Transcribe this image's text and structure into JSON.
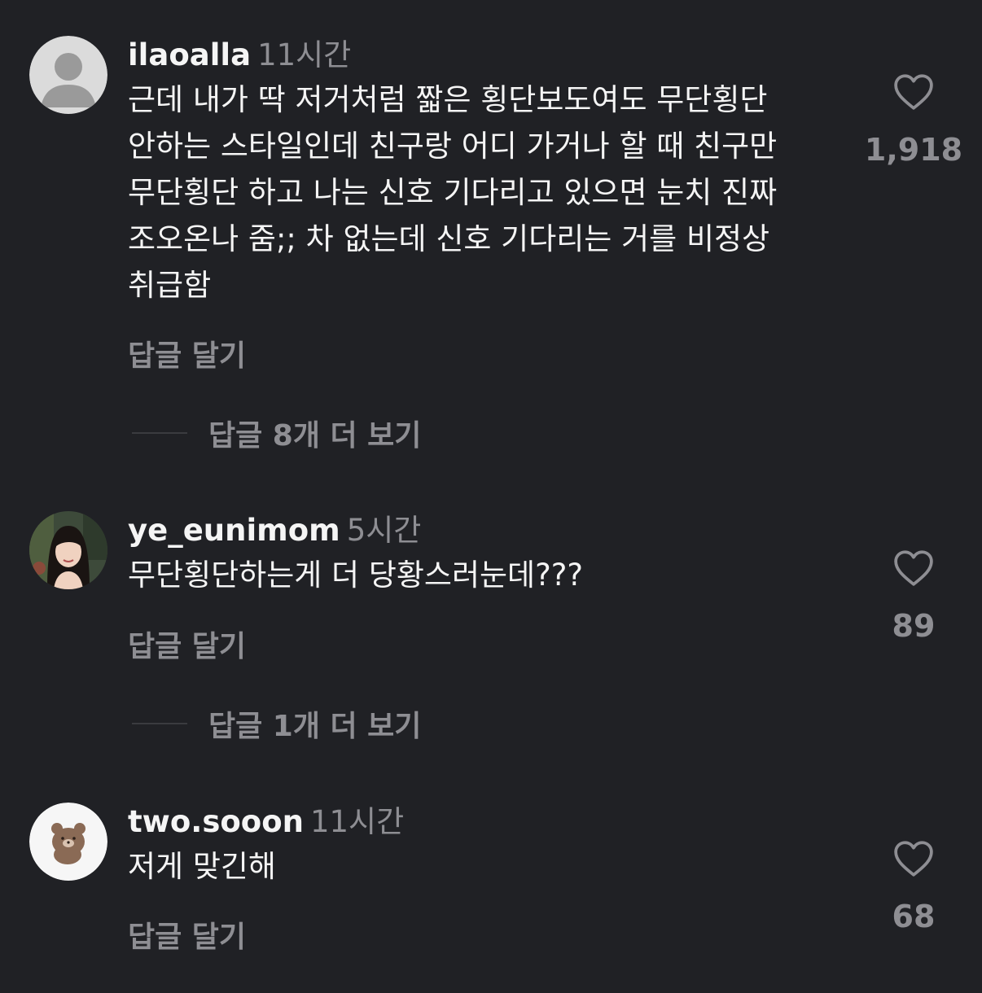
{
  "comments": [
    {
      "username": "ilaoalla",
      "time": "11시간",
      "text": "근데 내가 딱 저거처럼 짧은 횡단보도여도 무단횡단 안하는 스타일인데 친구랑 어디 가거나 할 때 친구만 무단횡단 하고 나는 신호 기다리고 있으면 눈치 진짜 조오온나 줌;; 차 없는데 신호 기다리는 거를 비정상 취급함",
      "reply_label": "답글 달기",
      "more_replies": "답글 8개 더 보기",
      "likes": "1,918",
      "avatar_icon": "default-person-avatar"
    },
    {
      "username": "ye_eunimom",
      "time": "5시간",
      "text": "무단횡단하는게 더 당황스러눈데???",
      "reply_label": "답글 달기",
      "more_replies": "답글 1개 더 보기",
      "likes": "89",
      "avatar_icon": "profile-photo-avatar"
    },
    {
      "username": "two.sooon",
      "time": "11시간",
      "text": "저게 맞긴해",
      "reply_label": "답글 달기",
      "likes": "68",
      "avatar_icon": "bear-character-avatar"
    }
  ],
  "icons": {
    "like": "heart-outline-icon"
  },
  "colors": {
    "background": "#202125",
    "primary_text": "#f5f5f5",
    "secondary_text": "#8e8e93"
  }
}
